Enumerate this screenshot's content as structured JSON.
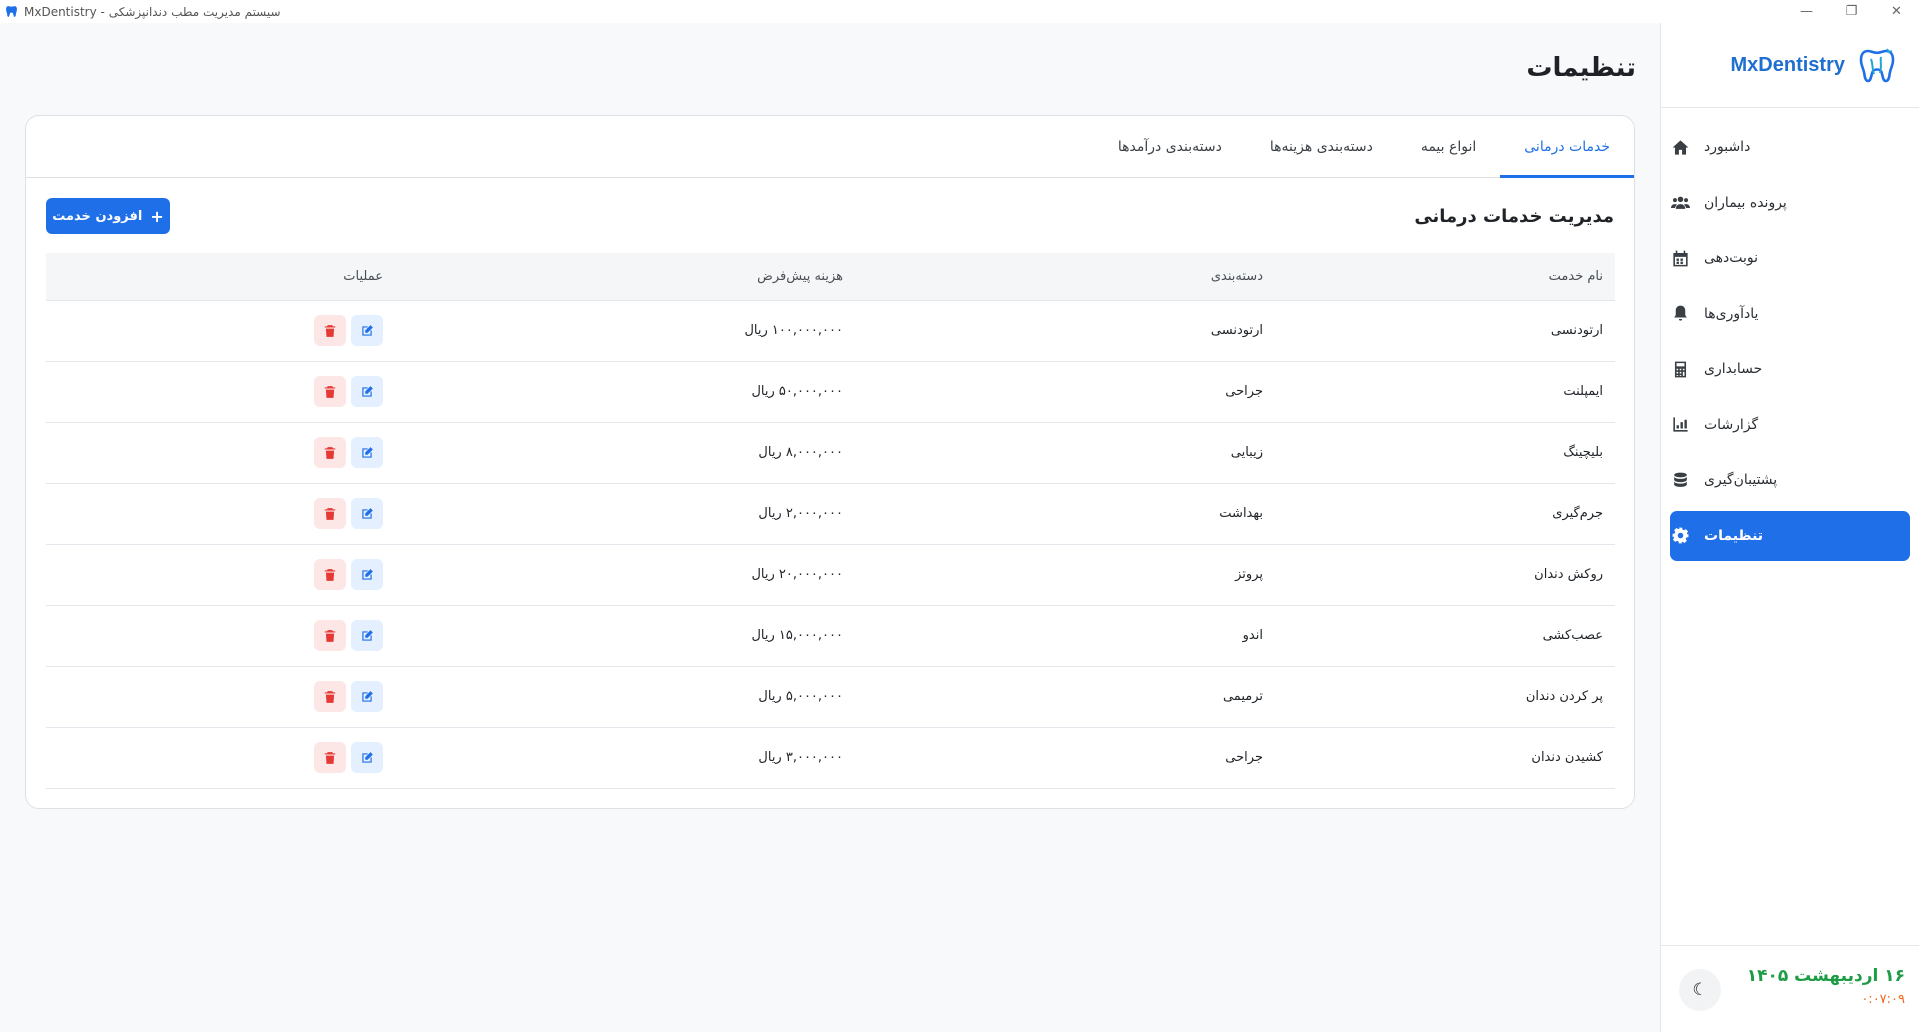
{
  "window": {
    "title": "MxDentistry - سیستم مدیریت مطب دندانپزشکی",
    "minimize_icon": "—",
    "restore_icon": "❐",
    "close_icon": "✕"
  },
  "sidebar": {
    "brand": "MxDentistry",
    "items": [
      {
        "label": "داشبورد",
        "icon": "home-icon"
      },
      {
        "label": "پرونده بیماران",
        "icon": "users-icon"
      },
      {
        "label": "نوبت‌دهی",
        "icon": "calendar-icon"
      },
      {
        "label": "یادآوری‌ها",
        "icon": "bell-icon"
      },
      {
        "label": "حسابداری",
        "icon": "calculator-icon"
      },
      {
        "label": "گزارشات",
        "icon": "chart-icon"
      },
      {
        "label": "پشتیبان‌گیری",
        "icon": "database-icon"
      },
      {
        "label": "تنظیمات",
        "icon": "gear-icon",
        "active": true
      }
    ],
    "footer": {
      "date": "۱۶ اردیبهشت ۱۴۰۵",
      "time": "۰:۰۷:۰۹",
      "theme_icon": "☾"
    }
  },
  "page": {
    "title": "تنظیمات"
  },
  "tabs": [
    {
      "label": "خدمات درمانی",
      "active": true
    },
    {
      "label": "انواع بیمه"
    },
    {
      "label": "دسته‌بندی هزینه‌ها"
    },
    {
      "label": "دسته‌بندی درآمدها"
    }
  ],
  "services": {
    "title": "مدیریت خدمات درمانی",
    "add_button": "افزودن خدمت",
    "add_icon": "+",
    "columns": {
      "name": "نام خدمت",
      "category": "دسته‌بندی",
      "price": "هزینه پیش‌فرض",
      "actions": "عملیات"
    },
    "rows": [
      {
        "name": "ارتودنسی",
        "category": "ارتودنسی",
        "price": "۱۰۰,۰۰۰,۰۰۰ ریال"
      },
      {
        "name": "ایمپلنت",
        "category": "جراحی",
        "price": "۵۰,۰۰۰,۰۰۰ ریال"
      },
      {
        "name": "بلیچینگ",
        "category": "زیبایی",
        "price": "۸,۰۰۰,۰۰۰ ریال"
      },
      {
        "name": "جرم‌گیری",
        "category": "بهداشت",
        "price": "۲,۰۰۰,۰۰۰ ریال"
      },
      {
        "name": "روکش دندان",
        "category": "پروتز",
        "price": "۲۰,۰۰۰,۰۰۰ ریال"
      },
      {
        "name": "عصب‌کشی",
        "category": "اندو",
        "price": "۱۵,۰۰۰,۰۰۰ ریال"
      },
      {
        "name": "پر کردن دندان",
        "category": "ترمیمی",
        "price": "۵,۰۰۰,۰۰۰ ریال"
      },
      {
        "name": "کشیدن دندان",
        "category": "جراحی",
        "price": "۳,۰۰۰,۰۰۰ ریال"
      }
    ]
  },
  "colors": {
    "accent": "#1e6fe8",
    "date": "#1e9b45",
    "time": "#ef6a1e",
    "danger": "#e53935"
  }
}
